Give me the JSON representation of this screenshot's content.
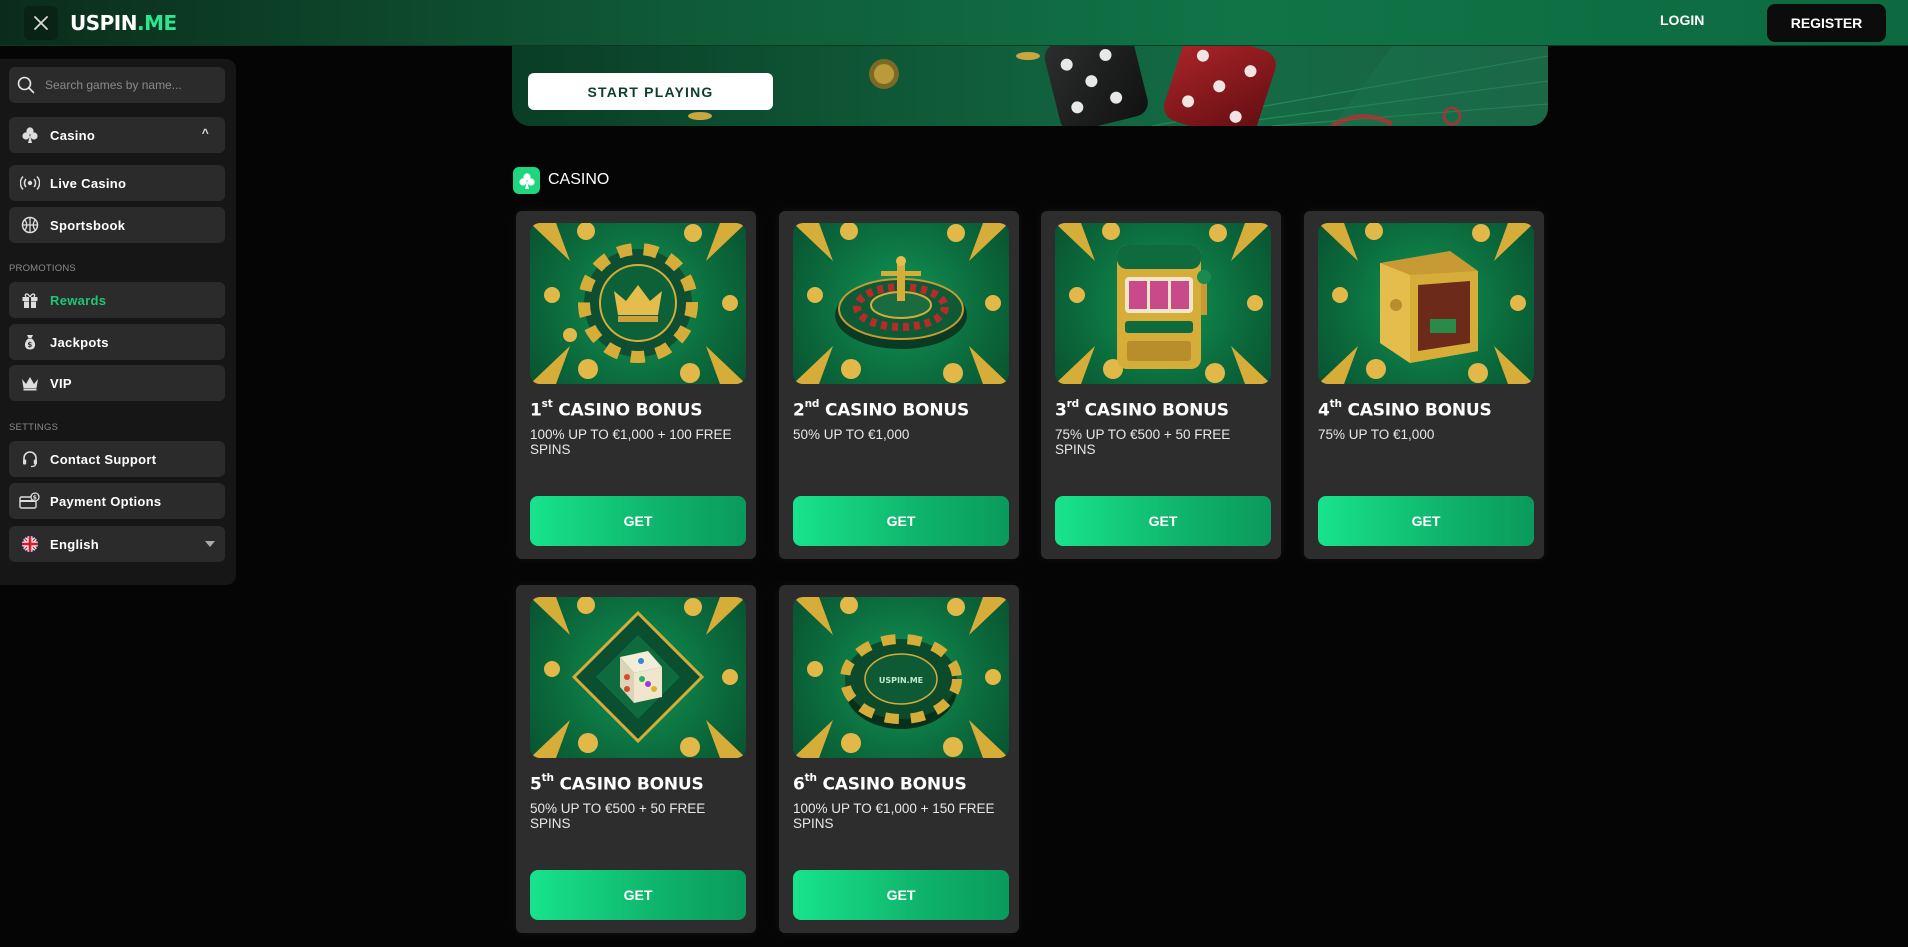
{
  "header": {
    "logo_main": "USPIN",
    "logo_suffix": ".ME",
    "login_label": "LOGIN",
    "register_label": "REGISTER"
  },
  "sidebar": {
    "search_placeholder": "Search games by name...",
    "items": [
      {
        "label": "Casino",
        "icon": "club-icon"
      },
      {
        "label": "Live Casino",
        "icon": "broadcast-icon"
      },
      {
        "label": "Sportsbook",
        "icon": "basketball-icon"
      }
    ],
    "promotions_title": "PROMOTIONS",
    "promotions": [
      {
        "label": "Rewards",
        "icon": "gift-icon",
        "active": true
      },
      {
        "label": "Jackpots",
        "icon": "money-bag-icon"
      },
      {
        "label": "VIP",
        "icon": "crown-icon"
      }
    ],
    "settings_title": "SETTINGS",
    "settings": [
      {
        "label": "Contact Support",
        "icon": "headset-icon"
      },
      {
        "label": "Payment Options",
        "icon": "payment-icon"
      }
    ],
    "language": {
      "label": "English",
      "icon": "uk-flag-icon"
    }
  },
  "hero": {
    "cta_label": "START PLAYING"
  },
  "section": {
    "title": "CASINO",
    "icon": "club-icon"
  },
  "cards": [
    {
      "number": "1",
      "suffix": "st",
      "title": "CASINO BONUS",
      "desc": "100% UP TO €1,000 + 100 FREE SPINS",
      "button": "GET",
      "art": "crown-chip"
    },
    {
      "number": "2",
      "suffix": "nd",
      "title": "CASINO BONUS",
      "desc": "50% UP TO €1,000",
      "button": "GET",
      "art": "roulette"
    },
    {
      "number": "3",
      "suffix": "rd",
      "title": "CASINO BONUS",
      "desc": "75% UP TO €500 + 50 FREE SPINS",
      "button": "GET",
      "art": "slot-machine"
    },
    {
      "number": "4",
      "suffix": "th",
      "title": "CASINO BONUS",
      "desc": "75% UP TO €1,000",
      "button": "GET",
      "art": "safe"
    },
    {
      "number": "5",
      "suffix": "th",
      "title": "CASINO BONUS",
      "desc": "50% UP TO €500 + 50 FREE SPINS",
      "button": "GET",
      "art": "dice"
    },
    {
      "number": "6",
      "suffix": "th",
      "title": "CASINO BONUS",
      "desc": "100% UP TO €1,000 + 150 FREE SPINS",
      "button": "GET",
      "art": "uspin-chip"
    }
  ],
  "chip_logo_text": "USPIN.ME",
  "colors": {
    "accent": "#1fd67e",
    "background": "#050505",
    "card": "#2d2d2d",
    "sidebar_item": "#2b2b2b"
  }
}
